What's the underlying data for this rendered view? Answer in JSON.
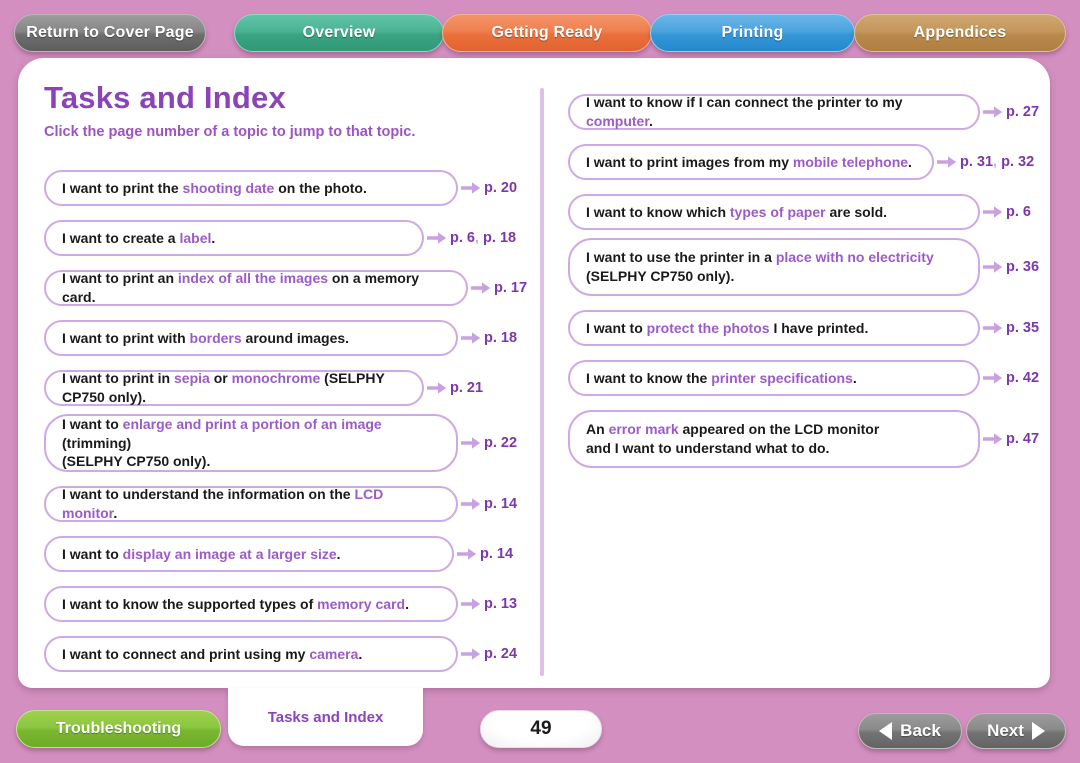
{
  "top_tabs": [
    {
      "label": "Return to Cover Page",
      "color": "#868686",
      "name": "cover"
    },
    {
      "label": "Overview",
      "color": "#4bb394",
      "name": "overview"
    },
    {
      "label": "Getting Ready",
      "color": "#ef7f4f",
      "name": "getting"
    },
    {
      "label": "Printing",
      "color": "#4ba4de",
      "name": "printing"
    },
    {
      "label": "Appendices",
      "color": "#c3975d",
      "name": "appendices"
    }
  ],
  "header": {
    "title": "Tasks and Index",
    "subtitle": "Click the page number of a topic to jump to that topic.",
    "title_color": "#8b44b8"
  },
  "left_column": [
    {
      "segments": [
        {
          "t": "I want to print the ",
          "hl": false
        },
        {
          "t": "shooting date",
          "hl": true
        },
        {
          "t": " on the photo.",
          "hl": false
        }
      ],
      "pages": "p. 20",
      "pages_list": [
        "p. 20"
      ]
    },
    {
      "segments": [
        {
          "t": "I want to create a ",
          "hl": false
        },
        {
          "t": "label",
          "hl": true
        },
        {
          "t": ".",
          "hl": false
        }
      ],
      "pages": "p. 6, p. 18",
      "pages_list": [
        "p. 6",
        "p. 18"
      ]
    },
    {
      "segments": [
        {
          "t": "I want to print an ",
          "hl": false
        },
        {
          "t": "index of all the images",
          "hl": true
        },
        {
          "t": " on a memory card.",
          "hl": false
        }
      ],
      "pages": "p. 17",
      "pages_list": [
        "p. 17"
      ]
    },
    {
      "segments": [
        {
          "t": "I want to print with ",
          "hl": false
        },
        {
          "t": "borders",
          "hl": true
        },
        {
          "t": " around images.",
          "hl": false
        }
      ],
      "pages": "p. 18",
      "pages_list": [
        "p. 18"
      ]
    },
    {
      "segments": [
        {
          "t": "I want to print in ",
          "hl": false
        },
        {
          "t": "sepia",
          "hl": true
        },
        {
          "t": " or ",
          "hl": false
        },
        {
          "t": "monochrome",
          "hl": true
        },
        {
          "t": " (SELPHY CP750 only).",
          "hl": false
        }
      ],
      "pages": "p. 21",
      "pages_list": [
        "p. 21"
      ]
    },
    {
      "segments": [
        {
          "t": "I want to ",
          "hl": false
        },
        {
          "t": "enlarge and print a portion of an image",
          "hl": true
        },
        {
          "t": " (trimming)",
          "hl": false
        },
        {
          "t": "\n",
          "hl": false
        },
        {
          "t": "(SELPHY CP750 only).",
          "hl": false
        }
      ],
      "pages": "p. 22",
      "pages_list": [
        "p. 22"
      ],
      "twoline": true
    },
    {
      "segments": [
        {
          "t": "I want to understand the information on the ",
          "hl": false
        },
        {
          "t": "LCD monitor",
          "hl": true
        },
        {
          "t": ".",
          "hl": false
        }
      ],
      "pages": "p. 14",
      "pages_list": [
        "p. 14"
      ]
    },
    {
      "segments": [
        {
          "t": "I want to ",
          "hl": false
        },
        {
          "t": "display an image at a larger size",
          "hl": true
        },
        {
          "t": ".",
          "hl": false
        }
      ],
      "pages": "p. 14",
      "pages_list": [
        "p. 14"
      ]
    },
    {
      "segments": [
        {
          "t": "I want to know the supported types of ",
          "hl": false
        },
        {
          "t": "memory card",
          "hl": true
        },
        {
          "t": ".",
          "hl": false
        }
      ],
      "pages": "p. 13",
      "pages_list": [
        "p. 13"
      ]
    },
    {
      "segments": [
        {
          "t": "I want to connect and print using my ",
          "hl": false
        },
        {
          "t": "camera",
          "hl": true
        },
        {
          "t": ".",
          "hl": false
        }
      ],
      "pages": "p. 24",
      "pages_list": [
        "p. 24"
      ]
    }
  ],
  "right_column": [
    {
      "segments": [
        {
          "t": "I want to know if I can connect the printer to my ",
          "hl": false
        },
        {
          "t": "computer",
          "hl": true
        },
        {
          "t": ".",
          "hl": false
        }
      ],
      "pages": "p. 27",
      "pages_list": [
        "p. 27"
      ]
    },
    {
      "segments": [
        {
          "t": "I want to print images from my ",
          "hl": false
        },
        {
          "t": "mobile telephone",
          "hl": true
        },
        {
          "t": ".",
          "hl": false
        }
      ],
      "pages": "p. 31, p. 32",
      "pages_list": [
        "p. 31",
        "p. 32"
      ]
    },
    {
      "segments": [
        {
          "t": "I want to know which ",
          "hl": false
        },
        {
          "t": "types of paper",
          "hl": true
        },
        {
          "t": " are sold.",
          "hl": false
        }
      ],
      "pages": "p. 6",
      "pages_list": [
        "p. 6"
      ]
    },
    {
      "segments": [
        {
          "t": "I want to use the printer in a ",
          "hl": false
        },
        {
          "t": "place with no electricity",
          "hl": true
        },
        {
          "t": "\n",
          "hl": false
        },
        {
          "t": "(SELPHY CP750 only).",
          "hl": false
        }
      ],
      "pages": "p. 36",
      "pages_list": [
        "p. 36"
      ],
      "twoline": true
    },
    {
      "segments": [
        {
          "t": "I want to ",
          "hl": false
        },
        {
          "t": "protect the photos",
          "hl": true
        },
        {
          "t": " I have printed.",
          "hl": false
        }
      ],
      "pages": "p. 35",
      "pages_list": [
        "p. 35"
      ]
    },
    {
      "segments": [
        {
          "t": "I want to know the ",
          "hl": false
        },
        {
          "t": "printer specifications",
          "hl": true
        },
        {
          "t": ".",
          "hl": false
        }
      ],
      "pages": "p. 42",
      "pages_list": [
        "p. 42"
      ]
    },
    {
      "segments": [
        {
          "t": "An ",
          "hl": false
        },
        {
          "t": "error mark",
          "hl": true
        },
        {
          "t": " appeared on the LCD monitor",
          "hl": false
        },
        {
          "t": "\n",
          "hl": false
        },
        {
          "t": "and I want to understand what to do.",
          "hl": false
        }
      ],
      "pages": "p. 47",
      "pages_list": [
        "p. 47"
      ],
      "twoline": true
    }
  ],
  "bottom_bar": {
    "troubleshooting_label": "Troubleshooting",
    "tasks_index_label": "Tasks and Index",
    "page_number": "49",
    "back_label": "Back",
    "next_label": "Next"
  },
  "colors": {
    "background": "#d38fc0",
    "accent_purple": "#8b44b8",
    "pill_border": "#cdaae5",
    "highlight_text": "#9b5bc8",
    "pageref": "#7d37ad",
    "divider": "#dfc1e8"
  }
}
